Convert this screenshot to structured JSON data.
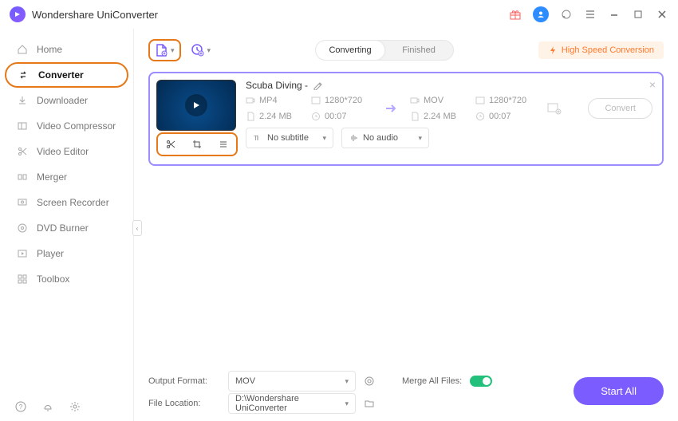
{
  "app": {
    "title": "Wondershare UniConverter"
  },
  "sidebar": {
    "items": [
      {
        "label": "Home"
      },
      {
        "label": "Converter"
      },
      {
        "label": "Downloader"
      },
      {
        "label": "Video Compressor"
      },
      {
        "label": "Video Editor"
      },
      {
        "label": "Merger"
      },
      {
        "label": "Screen Recorder"
      },
      {
        "label": "DVD Burner"
      },
      {
        "label": "Player"
      },
      {
        "label": "Toolbox"
      }
    ]
  },
  "topbar": {
    "tabs": {
      "converting": "Converting",
      "finished": "Finished"
    },
    "high_speed_label": "High Speed Conversion"
  },
  "file": {
    "title": "Scuba Diving -",
    "src": {
      "fmt": "MP4",
      "res": "1280*720",
      "size": "2.24 MB",
      "dur": "00:07"
    },
    "dst": {
      "fmt": "MOV",
      "res": "1280*720",
      "size": "2.24 MB",
      "dur": "00:07"
    },
    "subtitle": "No subtitle",
    "audio": "No audio",
    "convert_label": "Convert"
  },
  "footer": {
    "output_format_label": "Output Format:",
    "output_format_value": "MOV",
    "merge_label": "Merge All Files:",
    "file_location_label": "File Location:",
    "file_location_value": "D:\\Wondershare UniConverter",
    "start_all": "Start All"
  }
}
